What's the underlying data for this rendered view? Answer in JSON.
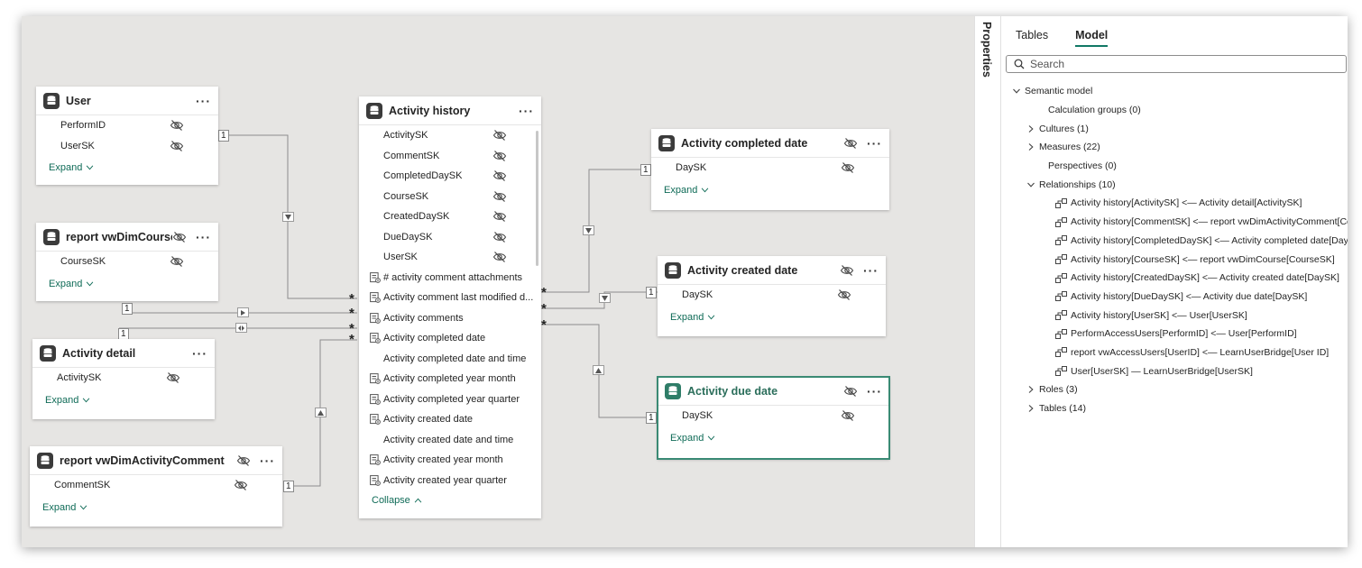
{
  "tables": {
    "user": {
      "title": "User",
      "fields": [
        "PerformID",
        "UserSK"
      ],
      "expand": "Expand"
    },
    "course": {
      "title": "report vwDimCourse",
      "fields": [
        "CourseSK"
      ],
      "expand": "Expand"
    },
    "detail": {
      "title": "Activity detail",
      "fields": [
        "ActivitySK"
      ],
      "expand": "Expand"
    },
    "comment": {
      "title": "report vwDimActivityComment",
      "fields": [
        "CommentSK"
      ],
      "expand": "Expand"
    },
    "history": {
      "title": "Activity history",
      "fields": [
        "ActivitySK",
        "CommentSK",
        "CompletedDaySK",
        "CourseSK",
        "CreatedDaySK",
        "DueDaySK",
        "UserSK"
      ],
      "columns": [
        {
          "label": "# activity comment attachments",
          "icon": "measure"
        },
        {
          "label": "Activity comment last modified d...",
          "icon": "measure"
        },
        {
          "label": "Activity comments",
          "icon": "measure"
        },
        {
          "label": "Activity completed date",
          "icon": "measure"
        },
        {
          "label": "Activity completed date and time",
          "icon": "none"
        },
        {
          "label": "Activity completed year month",
          "icon": "measure"
        },
        {
          "label": "Activity completed year quarter",
          "icon": "measure"
        },
        {
          "label": "Activity created date",
          "icon": "measure"
        },
        {
          "label": "Activity created date and time",
          "icon": "none"
        },
        {
          "label": "Activity created year month",
          "icon": "measure"
        },
        {
          "label": "Activity created year quarter",
          "icon": "measure"
        }
      ],
      "collapse": "Collapse"
    },
    "completed": {
      "title": "Activity completed date",
      "fields": [
        "DaySK"
      ],
      "expand": "Expand"
    },
    "created": {
      "title": "Activity created date",
      "fields": [
        "DaySK"
      ],
      "expand": "Expand"
    },
    "due": {
      "title": "Activity due date",
      "fields": [
        "DaySK"
      ],
      "expand": "Expand"
    }
  },
  "cardinality": {
    "one": "1",
    "many": "*"
  },
  "properties_label": "Properties",
  "panel": {
    "tabs": [
      "Tables",
      "Model"
    ],
    "active_tab": "Model",
    "search_placeholder": "Search",
    "tree": {
      "root": "Semantic model",
      "calc_groups": "Calculation groups (0)",
      "cultures": "Cultures (1)",
      "measures": "Measures (22)",
      "perspectives": "Perspectives (0)",
      "relationships": "Relationships (10)",
      "relationship_items": [
        "Activity history[ActivitySK] <— Activity detail[ActivitySK]",
        "Activity history[CommentSK] <— report vwDimActivityComment[Co...",
        "Activity history[CompletedDaySK] <— Activity completed date[Day...",
        "Activity history[CourseSK] <— report vwDimCourse[CourseSK]",
        "Activity history[CreatedDaySK] <— Activity created date[DaySK]",
        "Activity history[DueDaySK] <— Activity due date[DaySK]",
        "Activity history[UserSK] <— User[UserSK]",
        "PerformAccessUsers[PerformID] <— User[PerformID]",
        "report vwAccessUsers[UserID] <— LearnUserBridge[User ID]",
        "User[UserSK] — LearnUserBridge[UserSK]"
      ],
      "roles": "Roles (3)",
      "tables": "Tables (14)"
    }
  },
  "colors": {
    "canvas": "#e6e5e3",
    "accent": "#117865",
    "selected": "#2f7d68"
  }
}
